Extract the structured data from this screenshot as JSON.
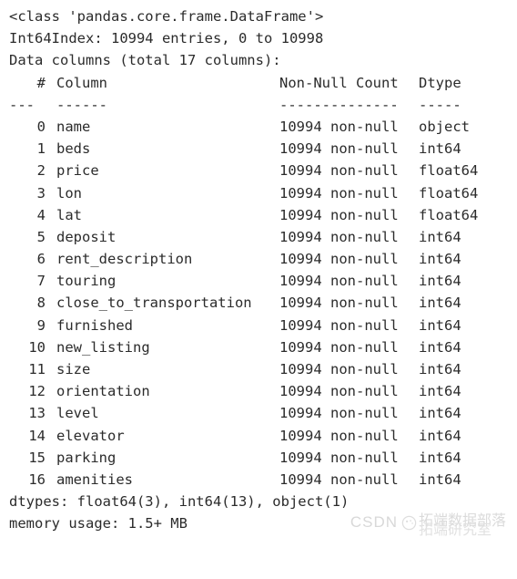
{
  "output": {
    "header_lines": [
      "<class 'pandas.core.frame.DataFrame'>",
      "Int64Index: 10994 entries, 0 to 10998",
      "Data columns (total 17 columns):"
    ],
    "table_header": {
      "index": "#",
      "column": "Column",
      "non_null": "Non-Null Count",
      "dtype": "Dtype"
    },
    "table_rule": {
      "index": "---",
      "column": "------",
      "non_null": "--------------",
      "dtype": "-----"
    },
    "rows": [
      {
        "index": "0",
        "column": "name",
        "non_null": "10994 non-null",
        "dtype": "object"
      },
      {
        "index": "1",
        "column": "beds",
        "non_null": "10994 non-null",
        "dtype": "int64"
      },
      {
        "index": "2",
        "column": "price",
        "non_null": "10994 non-null",
        "dtype": "float64"
      },
      {
        "index": "3",
        "column": "lon",
        "non_null": "10994 non-null",
        "dtype": "float64"
      },
      {
        "index": "4",
        "column": "lat",
        "non_null": "10994 non-null",
        "dtype": "float64"
      },
      {
        "index": "5",
        "column": "deposit",
        "non_null": "10994 non-null",
        "dtype": "int64"
      },
      {
        "index": "6",
        "column": "rent_description",
        "non_null": "10994 non-null",
        "dtype": "int64"
      },
      {
        "index": "7",
        "column": "touring",
        "non_null": "10994 non-null",
        "dtype": "int64"
      },
      {
        "index": "8",
        "column": "close_to_transportation",
        "non_null": "10994 non-null",
        "dtype": "int64"
      },
      {
        "index": "9",
        "column": "furnished",
        "non_null": "10994 non-null",
        "dtype": "int64"
      },
      {
        "index": "10",
        "column": "new_listing",
        "non_null": "10994 non-null",
        "dtype": "int64"
      },
      {
        "index": "11",
        "column": "size",
        "non_null": "10994 non-null",
        "dtype": "int64"
      },
      {
        "index": "12",
        "column": "orientation",
        "non_null": "10994 non-null",
        "dtype": "int64"
      },
      {
        "index": "13",
        "column": "level",
        "non_null": "10994 non-null",
        "dtype": "int64"
      },
      {
        "index": "14",
        "column": "elevator",
        "non_null": "10994 non-null",
        "dtype": "int64"
      },
      {
        "index": "15",
        "column": "parking",
        "non_null": "10994 non-null",
        "dtype": "int64"
      },
      {
        "index": "16",
        "column": "amenities",
        "non_null": "10994 non-null",
        "dtype": "int64"
      }
    ],
    "footer_lines": [
      "dtypes: float64(3), int64(13), object(1)",
      "memory usage: 1.5+ MB"
    ]
  },
  "watermark": {
    "brand": "CSDN",
    "logo_icon": "csdn-paw-logo-icon",
    "cn_top": "拓端数据部落",
    "cn_bottom": "拓端研究室"
  },
  "colors": {
    "background": "#ffffff",
    "text": "#2b2b2b",
    "watermark": "#bdbdbd"
  }
}
